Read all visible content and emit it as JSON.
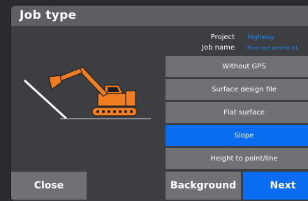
{
  "window": {
    "title": "Job type"
  },
  "info": {
    "project_label": "Project",
    "project_value": "Highway",
    "job_name_label": "Job name",
    "job_name_value": "Point and permile 01"
  },
  "options": [
    {
      "label": "Without GPS",
      "selected": false
    },
    {
      "label": "Surface design file",
      "selected": false
    },
    {
      "label": "Flat surface",
      "selected": false
    },
    {
      "label": "Slope",
      "selected": true
    },
    {
      "label": "Height to point/line",
      "selected": false
    }
  ],
  "footer": {
    "close_label": "Close",
    "background_label": "Background",
    "next_label": "Next"
  },
  "colors": {
    "accent": "#0a6cf0",
    "link_text": "#1e88ff",
    "excavator": "#f07d22",
    "button": "#707174"
  }
}
